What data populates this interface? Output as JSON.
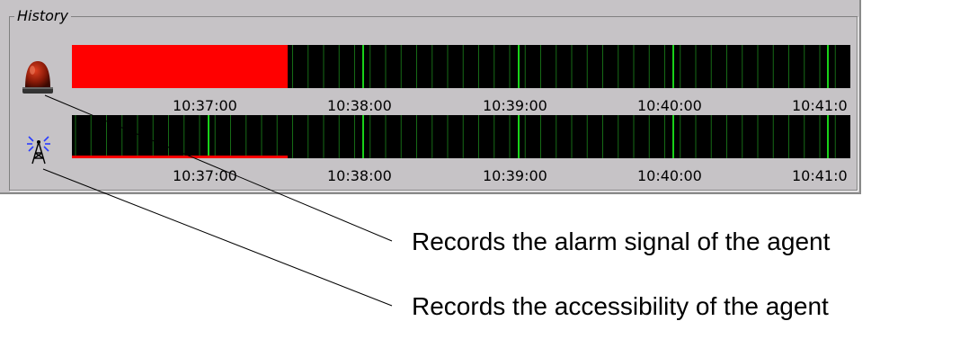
{
  "history": {
    "title": "History",
    "colors": {
      "grid_minor": "#166b16",
      "grid_major": "#19d219",
      "alarm": "#ff0000",
      "background": "#000000"
    },
    "alarm_row": {
      "icon": "alarm-light-icon",
      "ticks": [
        "10:37:00",
        "10:38:00",
        "10:39:00",
        "10:40:00",
        "10:41:0"
      ]
    },
    "access_row": {
      "icon": "antenna-icon",
      "ticks": [
        "10:37:00",
        "10:38:00",
        "10:39:00",
        "10:40:00",
        "10:41:0"
      ]
    }
  },
  "callouts": {
    "alarm": "Records the alarm signal of the agent",
    "access": "Records the accessibility of the agent"
  }
}
